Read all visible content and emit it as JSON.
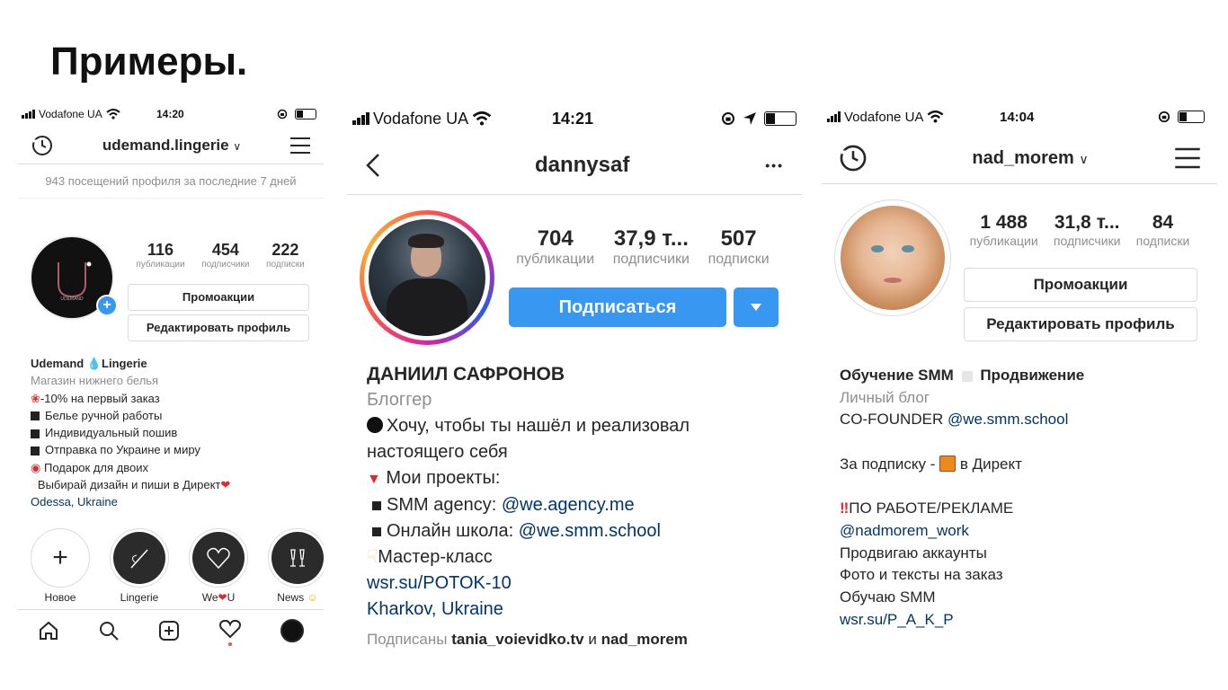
{
  "slide_title": "Примеры.",
  "phone1": {
    "carrier": "Vodafone UA",
    "time": "14:20",
    "username": "udemand.lingerie",
    "insight": "943 посещений профиля за последние 7 дней",
    "stats": {
      "posts": "116",
      "posts_label": "публикации",
      "followers": "454",
      "followers_label": "подписчики",
      "following": "222",
      "following_label": "подписки"
    },
    "btn_promo": "Промоакции",
    "btn_edit": "Редактировать профиль",
    "name": "Udemand",
    "name_suffix": "Lingerie",
    "category": "Магазин нижнего белья",
    "bio": [
      "-10% на первый заказ",
      "Белье ручной работы",
      "Индивидуальный пошив",
      "Отправка по Украине и миру",
      "Подарок для двоих",
      "Выбирай дизайн и пиши в Директ"
    ],
    "location": "Odessa, Ukraine",
    "highlights": [
      "Новое",
      "Lingerie",
      "We",
      "U",
      "News"
    ],
    "avatar_mark": "U",
    "avatar_sub": "UDEMAND"
  },
  "phone2": {
    "carrier": "Vodafone UA",
    "time": "14:21",
    "username": "dannysaf",
    "more": "•••",
    "stats": {
      "posts": "704",
      "posts_label": "публикации",
      "followers": "37,9 т...",
      "followers_label": "подписчики",
      "following": "507",
      "following_label": "подписки"
    },
    "btn_follow": "Подписаться",
    "name": "ДАНИИЛ САФРОНОВ",
    "category": "Блоггер",
    "bio_line1": "Хочу, чтобы ты нашёл и реализовал",
    "bio_line2": "настоящего себя",
    "bio_line3": "Мои проекты:",
    "bio_line4": "SMM agency: ",
    "bio_link4": "@we.agency.me",
    "bio_line5": "Онлайн школа: ",
    "bio_link5": "@we.smm.school",
    "bio_line6": "Мастер-класс",
    "url": "wsr.su/POTOK-10",
    "location": "Kharkov, Ukraine",
    "followed_prefix": "Подписаны ",
    "followed_user1": "tania_voievidko.tv",
    "followed_and": " и ",
    "followed_user2": "nad_morem"
  },
  "phone3": {
    "carrier": "Vodafone UA",
    "time": "14:04",
    "username": "nad_morem",
    "stats": {
      "posts": "1 488",
      "posts_label": "публикации",
      "followers": "31,8 т...",
      "followers_label": "подписчики",
      "following": "84",
      "following_label": "подписки"
    },
    "btn_promo": "Промоакции",
    "btn_edit": "Редактировать профиль",
    "name1": "Обучение SMM",
    "name2": "Продвижение",
    "category": "Личный блог",
    "cofounder": "CO-FOUNDER ",
    "cofounder_link": "@we.smm.school",
    "sub_prefix": "За подписку - ",
    "sub_suffix": " в Директ",
    "work": "ПО РАБОТЕ/РЕКЛАМЕ",
    "work_link": "@nadmorem_work",
    "line1": "Продвигаю аккаунты",
    "line2": "Фото и тексты на заказ",
    "line3": "Обучаю SMM",
    "url": "wsr.su/P_A_K_P"
  },
  "colors": {
    "link": "#003569",
    "follow_blue": "#3897f0",
    "grey": "#8e8e8e",
    "border": "#dbdbdb"
  }
}
